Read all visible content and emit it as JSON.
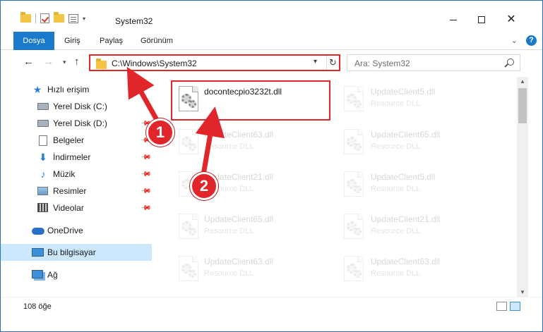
{
  "window": {
    "title": "System32",
    "controls": {
      "minimize": "",
      "maximize": "",
      "close": "✕"
    }
  },
  "ribbon": {
    "tabs": [
      {
        "label": "Dosya",
        "active": true
      },
      {
        "label": "Giriş"
      },
      {
        "label": "Paylaş"
      },
      {
        "label": "Görünüm"
      }
    ],
    "help": "?"
  },
  "nav": {
    "back": "←",
    "forward": "→",
    "recent": "▾",
    "up": "↑",
    "address": "C:\\Windows\\System32",
    "address_dropdown": "▾",
    "refresh": "↻",
    "search_placeholder": "Ara: System32"
  },
  "sidebar": {
    "items": [
      {
        "label": "Hızlı erişim",
        "icon": "star-icon"
      },
      {
        "label": "Yerel Disk (C:)",
        "icon": "drive-icon",
        "pinned": true
      },
      {
        "label": "Yerel Disk (D:)",
        "icon": "drive-icon",
        "pinned": true
      },
      {
        "label": "Belgeler",
        "icon": "document-icon",
        "pinned": true
      },
      {
        "label": "İndirmeler",
        "icon": "download-icon",
        "pinned": true
      },
      {
        "label": "Müzik",
        "icon": "music-icon",
        "pinned": true
      },
      {
        "label": "Resimler",
        "icon": "pictures-icon",
        "pinned": true
      },
      {
        "label": "Videolar",
        "icon": "videos-icon",
        "pinned": true
      },
      {
        "label": "OneDrive",
        "icon": "onedrive-icon"
      },
      {
        "label": "Bu bilgisayar",
        "icon": "this-pc-icon",
        "selected": true
      },
      {
        "label": "Ağ",
        "icon": "network-icon"
      }
    ]
  },
  "files": {
    "highlighted": {
      "name": "docontecpio3232t.dll",
      "type": ""
    },
    "faded": [
      {
        "name": "UpdateClient5.dll",
        "type": "Resource DLL"
      },
      {
        "name": "UpdateClient63.dll",
        "type": "Resource DLL"
      },
      {
        "name": "UpdateClient65.dll",
        "type": "Resource DLL"
      },
      {
        "name": "UpdateClient21.dll",
        "type": "Resource DLL"
      },
      {
        "name": "UpdateClient5.dll",
        "type": "Resource DLL"
      },
      {
        "name": "UpdateClient65.dll",
        "type": "Resource DLL"
      },
      {
        "name": "UpdateClient21.dll",
        "type": "Resource DLL"
      },
      {
        "name": "UpdateClient63.dll",
        "type": "Resource DLL"
      },
      {
        "name": "UpdateClient63.dll",
        "type": "Resource DLL"
      }
    ]
  },
  "status": {
    "count": "108 öğe"
  },
  "annotations": {
    "step1": "1",
    "step2": "2"
  },
  "colors": {
    "accent": "#1979ca",
    "highlight": "#e0262b",
    "selected": "#cce8ff"
  }
}
